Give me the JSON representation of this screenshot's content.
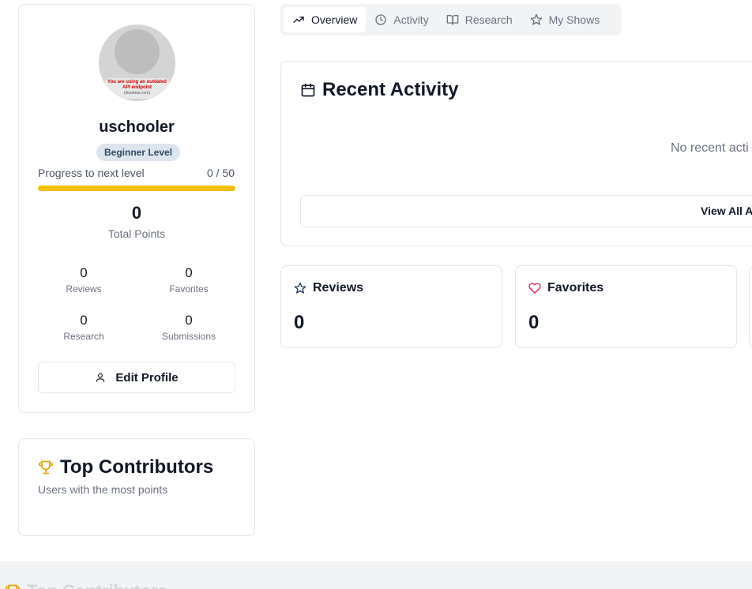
{
  "profile": {
    "avatar_warning_line1": "You are using an outdated API endpoint",
    "avatar_warning_line2": "(dicebear.com)",
    "username": "uschooler",
    "level": "Beginner Level",
    "progress_label": "Progress to next level",
    "progress_value": "0 / 50",
    "progress_fraction": 1.0,
    "total_points": "0",
    "total_points_label": "Total Points",
    "stats": [
      {
        "value": "0",
        "label": "Reviews"
      },
      {
        "value": "0",
        "label": "Favorites"
      },
      {
        "value": "0",
        "label": "Research"
      },
      {
        "value": "0",
        "label": "Submissions"
      }
    ],
    "edit_button": "Edit Profile"
  },
  "contributors": {
    "title": "Top Contributors",
    "subtitle": "Users with the most points"
  },
  "tabs": [
    {
      "label": "Overview",
      "icon": "trending-up-icon",
      "active": true
    },
    {
      "label": "Activity",
      "icon": "clock-icon",
      "active": false
    },
    {
      "label": "Research",
      "icon": "book-open-icon",
      "active": false
    },
    {
      "label": "My Shows",
      "icon": "star-icon",
      "active": false
    }
  ],
  "activity": {
    "title": "Recent Activity",
    "empty_text": "No recent acti",
    "view_all": "View All A"
  },
  "cards": [
    {
      "title": "Reviews",
      "value": "0",
      "icon": "star-icon"
    },
    {
      "title": "Favorites",
      "value": "0",
      "icon": "heart-icon"
    }
  ],
  "bottom": {
    "title": "Top Contributors"
  },
  "colors": {
    "accent_yellow": "#f5c000",
    "badge_bg": "#dde6ef",
    "badge_text": "#2f4a63",
    "heart_red": "#e11d48",
    "trophy": "#e0a800"
  }
}
